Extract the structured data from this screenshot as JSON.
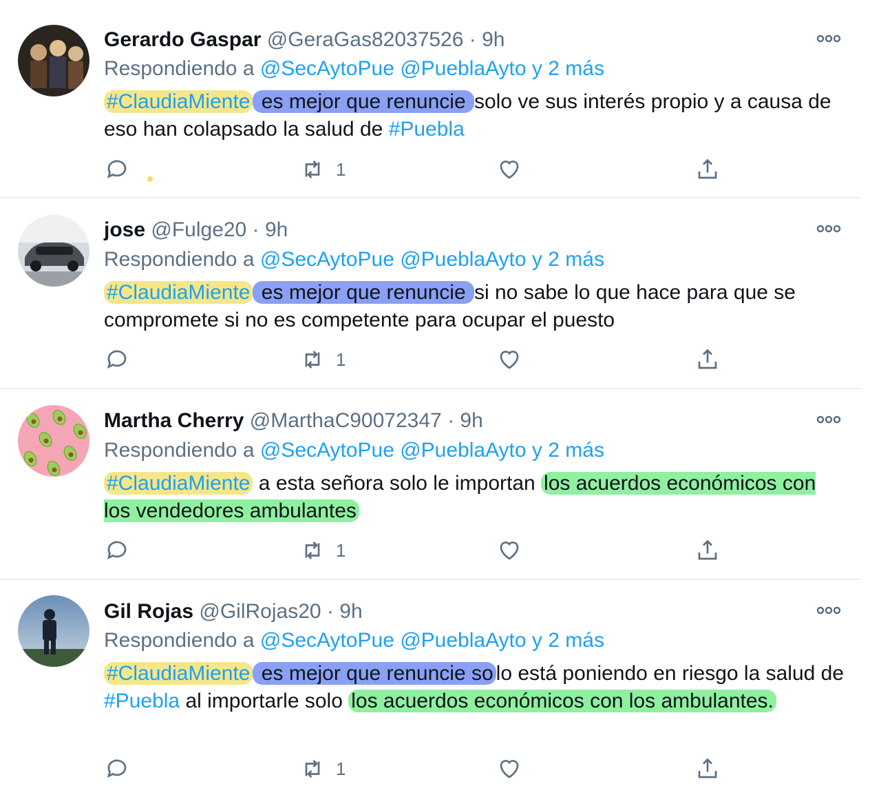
{
  "reply_label": "Respondiendo a",
  "mentions": [
    "@SecAytoPue",
    "@PueblaAyto",
    "y 2 más"
  ],
  "tweets": [
    {
      "name": "Gerardo Gaspar",
      "handle": "@GeraGas82037526",
      "dot": "·",
      "time": "9h",
      "segments": [
        {
          "text": "#ClaudiaMiente",
          "style": "hl-y hashtag"
        },
        {
          "text": " es mejor que renuncie ",
          "style": "hl-b"
        },
        {
          "text": "solo ve sus  interés propio y a causa de eso han colapsado la salud de ",
          "style": ""
        },
        {
          "text": "#Puebla",
          "style": "hashtag"
        }
      ],
      "retweets": "1",
      "avatar_icon": "person-group-icon"
    },
    {
      "name": "jose",
      "handle": "@Fulge20",
      "dot": "·",
      "time": "9h",
      "segments": [
        {
          "text": "#ClaudiaMiente",
          "style": "hl-y hashtag"
        },
        {
          "text": " es mejor que renuncie ",
          "style": "hl-b"
        },
        {
          "text": "si no sabe lo que hace para que se compromete si no es competente para ocupar el puesto",
          "style": ""
        }
      ],
      "retweets": "1",
      "avatar_icon": "car-icon"
    },
    {
      "name": "Martha Cherry",
      "handle": "@MarthaC90072347",
      "dot": "·",
      "time": "9h",
      "segments": [
        {
          "text": "#ClaudiaMiente",
          "style": "hl-y hashtag"
        },
        {
          "text": " a esta señora solo le importan ",
          "style": ""
        },
        {
          "text": "los acuerdos económicos con los vendedores ambulantes",
          "style": "hl-g"
        }
      ],
      "retweets": "1",
      "avatar_icon": "avocado-pattern-icon"
    },
    {
      "name": "Gil Rojas",
      "handle": "@GilRojas20",
      "dot": "·",
      "time": "9h",
      "segments": [
        {
          "text": "#ClaudiaMiente",
          "style": "hl-y hashtag"
        },
        {
          "text": "  es mejor que renuncie so",
          "style": "hl-b"
        },
        {
          "text": "lo está poniendo en riesgo la salud de ",
          "style": ""
        },
        {
          "text": "#Puebla",
          "style": "hashtag"
        },
        {
          "text": "  al importarle solo ",
          "style": ""
        },
        {
          "text": "los acuerdos económicos con los ambulantes.",
          "style": "hl-g"
        }
      ],
      "retweets": "1",
      "avatar_icon": "person-silhouette-icon"
    }
  ],
  "colors": {
    "link": "#1da1f2",
    "muted": "#5b7083",
    "highlight_yellow": "#f6e68a",
    "highlight_blue": "#8aa0f4",
    "highlight_green": "#8ff0a0"
  }
}
